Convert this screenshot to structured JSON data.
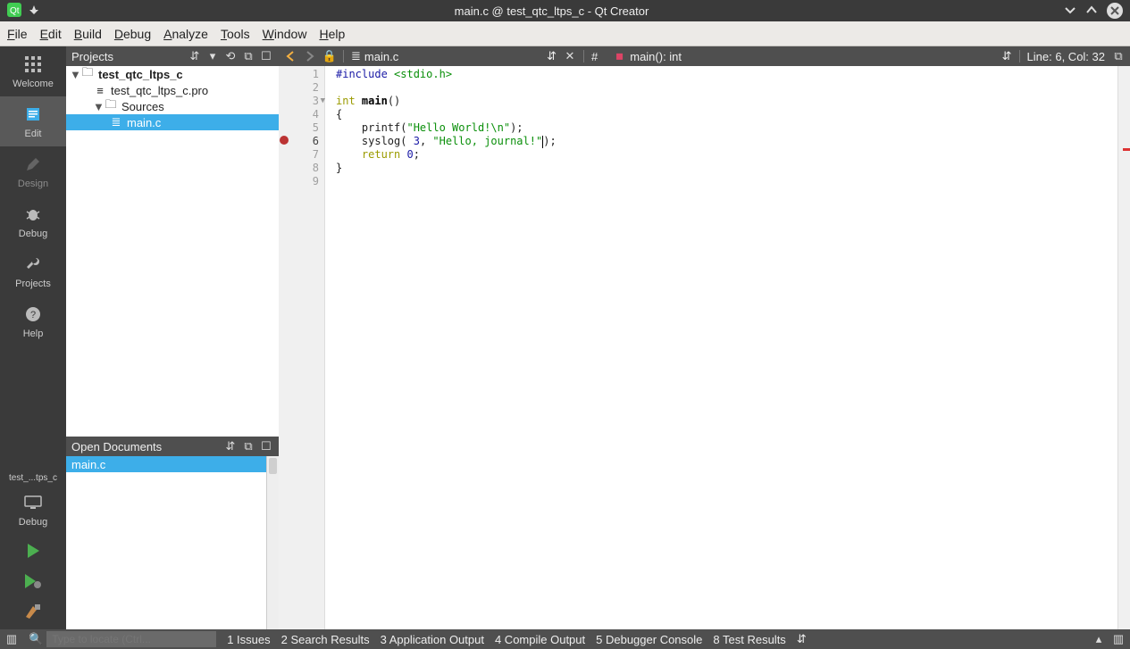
{
  "window": {
    "title": "main.c @ test_qtc_ltps_c - Qt Creator"
  },
  "menu": {
    "items": [
      "File",
      "Edit",
      "Build",
      "Debug",
      "Analyze",
      "Tools",
      "Window",
      "Help"
    ]
  },
  "activity": {
    "items": [
      {
        "label": "Welcome"
      },
      {
        "label": "Edit"
      },
      {
        "label": "Design"
      },
      {
        "label": "Debug"
      },
      {
        "label": "Projects"
      },
      {
        "label": "Help"
      }
    ],
    "kit": "test_...tps_c",
    "kit_mode": "Debug"
  },
  "projects": {
    "title": "Projects",
    "tree": {
      "root": "test_qtc_ltps_c",
      "pro_file": "test_qtc_ltps_c.pro",
      "sources_label": "Sources",
      "file": "main.c"
    }
  },
  "open_docs": {
    "title": "Open Documents",
    "items": [
      "main.c"
    ]
  },
  "editor": {
    "filename": "main.c",
    "symbol": "main(): int",
    "cursor": "Line: 6, Col: 32",
    "line_count": 9
  },
  "code": {
    "l1_pp": "#include ",
    "l1_inc": "<stdio.h>",
    "l3_kw": "int ",
    "l3_fn": "main",
    "l3_rest": "()",
    "l4": "{",
    "l5a": "    printf(",
    "l5s": "\"Hello World!\\n\"",
    "l5b": ");",
    "l6a": "    syslog( ",
    "l6n": "3",
    "l6b": ", ",
    "l6s": "\"Hello, journal!\"",
    "l6c": ");",
    "l7a": "    ",
    "l7kw": "return ",
    "l7n": "0",
    "l7b": ";",
    "l8": "}"
  },
  "bottom": {
    "locator_placeholder": "Type to locate (Ctrl...",
    "items": [
      "1  Issues",
      "2  Search Results",
      "3  Application Output",
      "4  Compile Output",
      "5  Debugger Console",
      "8  Test Results"
    ]
  }
}
